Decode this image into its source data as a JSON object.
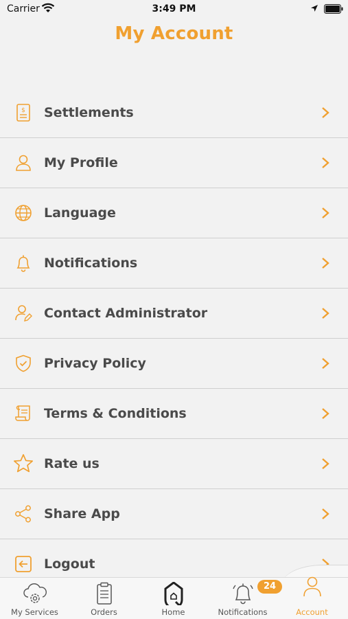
{
  "status_bar": {
    "carrier": "Carrier",
    "time": "3:49 PM"
  },
  "header": {
    "title": "My Account"
  },
  "menu": {
    "items": [
      {
        "label": "Settlements",
        "icon": "settlements-icon"
      },
      {
        "label": "My Profile",
        "icon": "profile-icon"
      },
      {
        "label": "Language",
        "icon": "globe-icon"
      },
      {
        "label": "Notifications",
        "icon": "bell-icon"
      },
      {
        "label": "Contact Administrator",
        "icon": "contact-admin-icon"
      },
      {
        "label": "Privacy Policy",
        "icon": "shield-icon"
      },
      {
        "label": "Terms & Conditions",
        "icon": "scroll-icon"
      },
      {
        "label": "Rate us",
        "icon": "star-icon"
      },
      {
        "label": "Share App",
        "icon": "share-icon"
      },
      {
        "label": "Logout",
        "icon": "logout-icon"
      }
    ]
  },
  "tab_bar": {
    "tabs": [
      {
        "label": "My Services",
        "icon": "cloud-gear-icon"
      },
      {
        "label": "Orders",
        "icon": "clipboard-icon"
      },
      {
        "label": "Home",
        "icon": "home-q-icon"
      },
      {
        "label": "Notifications",
        "icon": "bell-icon",
        "badge": "24"
      },
      {
        "label": "Account",
        "icon": "user-icon",
        "active": true
      }
    ]
  },
  "colors": {
    "accent": "#f0a030",
    "text": "#4a4a4a",
    "background": "#f2f2f2"
  }
}
